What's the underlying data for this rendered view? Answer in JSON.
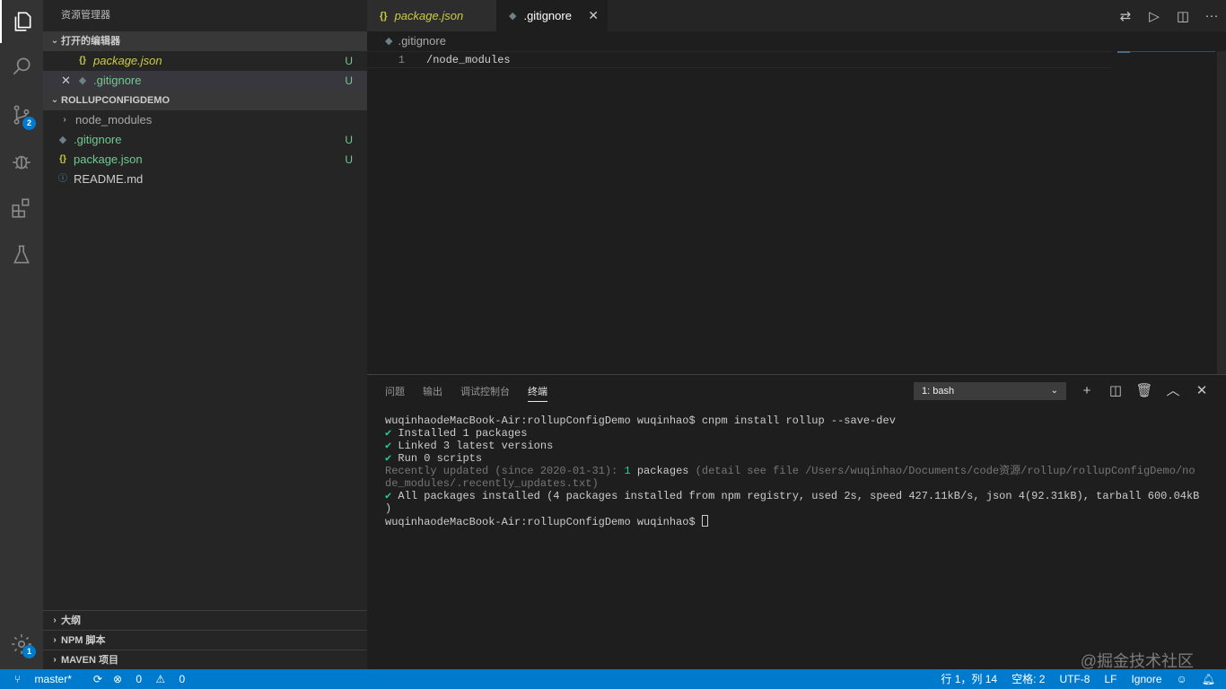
{
  "activity_bar": {
    "scm_badge": "2",
    "settings_badge": "1"
  },
  "sidebar": {
    "title": "资源管理器",
    "open_editors": {
      "header": "打开的编辑器",
      "items": [
        {
          "name": "package.json",
          "icon": "{}",
          "status": "U"
        },
        {
          "name": ".gitignore",
          "icon": "◆",
          "status": "U"
        }
      ]
    },
    "project": {
      "header": "ROLLUPCONFIGDEMO",
      "items": [
        {
          "name": "node_modules",
          "status": ""
        },
        {
          "name": ".gitignore",
          "icon": "◆",
          "status": "U"
        },
        {
          "name": "package.json",
          "icon": "{}",
          "status": "U"
        },
        {
          "name": "README.md",
          "icon": "ⓘ",
          "status": ""
        }
      ]
    },
    "bottom": {
      "outline": "大纲",
      "npm": "NPM 脚本",
      "maven": "MAVEN 项目"
    }
  },
  "tabs": [
    {
      "label": "package.json",
      "icon": "{}"
    },
    {
      "label": ".gitignore",
      "icon": "◆"
    }
  ],
  "editor": {
    "breadcrumb": ".gitignore",
    "line_number": "1",
    "line_text": "/node_modules"
  },
  "panel": {
    "tabs": [
      "问题",
      "输出",
      "调试控制台",
      "终端"
    ],
    "terminal_select": "1: bash",
    "terminal": {
      "line1": "wuqinhaodeMacBook-Air:rollupConfigDemo wuqinhao$ cnpm install rollup --save-dev",
      "check": "✔",
      "line2": " Installed 1 packages",
      "line3": " Linked 3 latest versions",
      "line4": " Run 0 scripts",
      "line5a": "Recently updated (since 2020-01-31): ",
      "line5b": "1",
      "line5c": " packages",
      "line5d": " (detail see file /Users/wuqinhao/Documents/code资源/rollup/rollupConfigDemo/no",
      "line6": "de_modules/.recently_updates.txt)",
      "line7": " All packages installed (4 packages installed from npm registry, used 2s, speed 427.11kB/s, json 4(92.31kB), tarball 600.04kB",
      "line8": ")",
      "line9": "wuqinhaodeMacBook-Air:rollupConfigDemo wuqinhao$ "
    }
  },
  "statusbar": {
    "branch": "master*",
    "errors": "0",
    "warnings": "0",
    "position": "行 1，列 14",
    "indent": "空格: 2",
    "encoding": "UTF-8",
    "eol": "LF",
    "language": "Ignore"
  },
  "watermark": "@掘金技术社区"
}
